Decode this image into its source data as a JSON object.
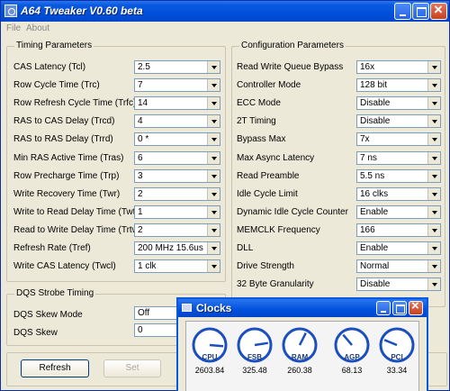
{
  "window": {
    "title": "A64 Tweaker V0.60 beta"
  },
  "menu": [
    "File",
    "About"
  ],
  "timing": {
    "legend": "Timing Parameters",
    "rows": [
      {
        "label": "CAS Latency (Tcl)",
        "value": "2.5"
      },
      {
        "label": "Row Cycle Time (Trc)",
        "value": "7"
      },
      {
        "label": "Row Refresh Cycle Time (Trfc)",
        "value": "14"
      },
      {
        "label": "RAS to CAS Delay (Trcd)",
        "value": "4"
      },
      {
        "label": "RAS to RAS Delay (Trrd)",
        "value": "0 *"
      },
      {
        "label": "Min RAS Active Time (Tras)",
        "value": "6"
      },
      {
        "label": "Row Precharge Time (Trp)",
        "value": "3"
      },
      {
        "label": "Write Recovery Time (Twr)",
        "value": "2"
      },
      {
        "label": "Write to Read Delay Time (Twtr)",
        "value": "1"
      },
      {
        "label": "Read to Write Delay Time (Trtw)",
        "value": "2"
      },
      {
        "label": "Refresh Rate (Tref)",
        "value": "200 MHz 15.6us"
      },
      {
        "label": "Write CAS Latency (Twcl)",
        "value": "1 clk"
      }
    ]
  },
  "config": {
    "legend": "Configuration Parameters",
    "rows": [
      {
        "label": "Read Write Queue Bypass",
        "value": "16x"
      },
      {
        "label": "Controller Mode",
        "value": "128 bit"
      },
      {
        "label": "ECC Mode",
        "value": "Disable"
      },
      {
        "label": "2T Timing",
        "value": "Disable"
      },
      {
        "label": "Bypass Max",
        "value": "7x"
      },
      {
        "label": "Max Async Latency",
        "value": "7 ns"
      },
      {
        "label": "Read Preamble",
        "value": "5.5 ns"
      },
      {
        "label": "Idle Cycle Limit",
        "value": "16 clks"
      },
      {
        "label": "Dynamic Idle Cycle Counter",
        "value": "Enable"
      },
      {
        "label": "MEMCLK Frequency",
        "value": "166"
      },
      {
        "label": "DLL",
        "value": "Enable"
      },
      {
        "label": "Drive Strength",
        "value": "Normal"
      },
      {
        "label": "32 Byte Granularity",
        "value": "Disable"
      }
    ]
  },
  "dqs": {
    "legend": "DQS Strobe Timing",
    "skew_mode_label": "DQS Skew Mode",
    "skew_mode_value": "Off",
    "skew_label": "DQS Skew",
    "skew_value": "0"
  },
  "buttons": {
    "refresh": "Refresh",
    "set": "Set"
  },
  "clocks": {
    "title": "Clocks",
    "gauges": [
      {
        "name": "CPU",
        "value": "2603.84",
        "level": 0.85
      },
      {
        "name": "FSB",
        "value": "325.48",
        "level": 0.8
      },
      {
        "name": "RAM",
        "value": "260.38",
        "level": 0.6
      },
      {
        "name": "AGP",
        "value": "68.13",
        "level": 0.35
      },
      {
        "name": "PCI",
        "value": "33.34",
        "level": 0.25
      }
    ]
  },
  "colors": {
    "title_bar": "#0a5ae0",
    "gauge_ring": "#1b4fbf",
    "close_button": "#c8401e"
  }
}
